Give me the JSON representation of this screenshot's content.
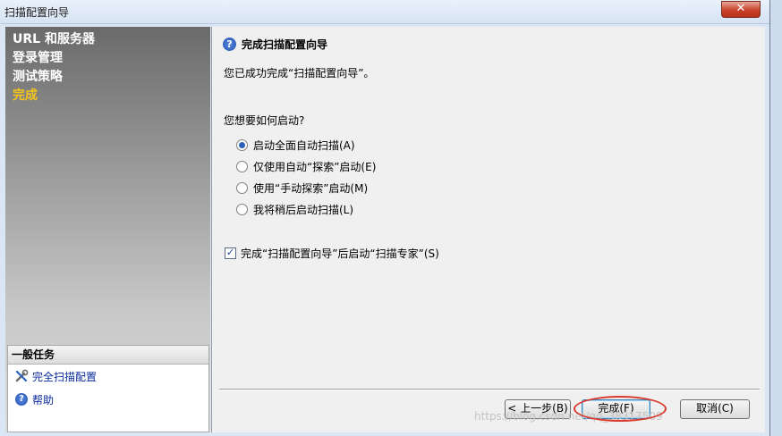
{
  "window": {
    "title": "扫描配置向导",
    "close_label": "✕"
  },
  "nav": {
    "items": [
      {
        "label": "URL 和服务器",
        "active": false
      },
      {
        "label": "登录管理",
        "active": false
      },
      {
        "label": "测试策略",
        "active": false
      },
      {
        "label": "完成",
        "active": true
      }
    ]
  },
  "tasks": {
    "header": "一般任务",
    "items": [
      {
        "label": "完全扫描配置",
        "icon": "tools-icon"
      },
      {
        "label": "帮助",
        "icon": "help-icon"
      }
    ]
  },
  "content": {
    "heading": "完成扫描配置向导",
    "success_text": "您已成功完成“扫描配置向导”。",
    "question": "您想要如何启动?",
    "options": [
      {
        "label": "启动全面自动扫描(A)",
        "checked": true
      },
      {
        "label": "仅使用自动“探索”启动(E)",
        "checked": false
      },
      {
        "label": "使用“手动探索”启动(M)",
        "checked": false
      },
      {
        "label": "我将稍后启动扫描(L)",
        "checked": false
      }
    ],
    "checkbox": {
      "label": "完成“扫描配置向导”后启动“扫描专家”(S)",
      "checked": true
    }
  },
  "buttons": {
    "prev": "< 上一步(B)",
    "finish": "完成(F)",
    "cancel": "取消(C)"
  },
  "watermark": "https://blog.csdn.net/qq_38317509",
  "colors": {
    "active_nav": "#f5c518",
    "annotation": "#d93a2e",
    "link": "#0a2b9c"
  }
}
